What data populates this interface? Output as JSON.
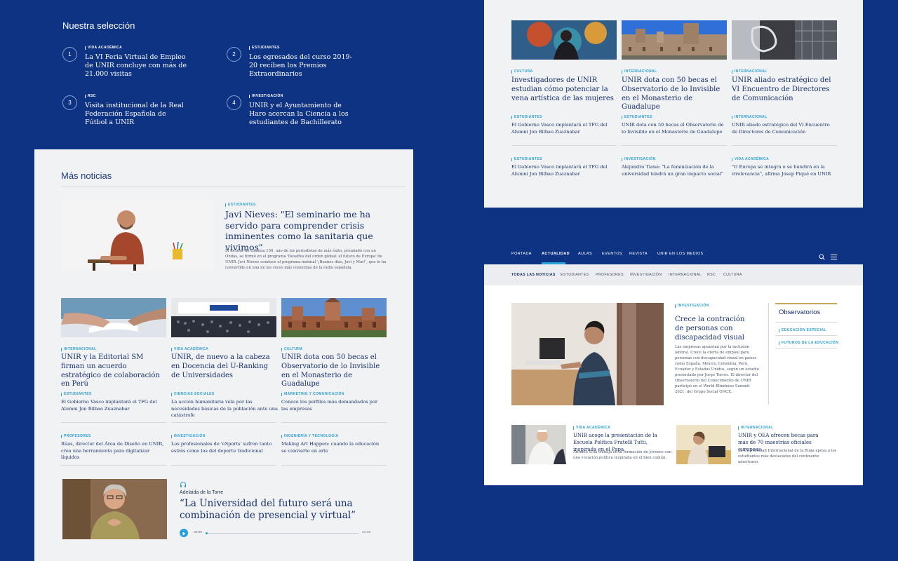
{
  "selection": {
    "title": "Nuestra selección",
    "items": [
      {
        "num": "1",
        "cat": "VIDA ACADÉMICA",
        "title": "La VI Feria Virtual de Empleo de UNIR concluye con más de 21.000 visitas"
      },
      {
        "num": "2",
        "cat": "ESTUDIANTES",
        "title": "Los egresados del curso 2019-20 reciben los Premios Extraordinarios"
      },
      {
        "num": "3",
        "cat": "RSC",
        "title": "Visita institucional de la Real Federación Española de Fútbol a UNIR"
      },
      {
        "num": "4",
        "cat": "INVESTIGACIÓN",
        "title": "UNIR y el Ayuntamiento de Haro acercan la Ciencia a los estudiantes de Bachillerato"
      }
    ]
  },
  "more": {
    "title": "Más noticias",
    "feature": {
      "cat": "ESTUDIANTES",
      "title": "Javi Nieves: \"El seminario me ha servido para comprender crisis inminentes como la sanitaria que vivimos\"",
      "body": "El locutor de Cadena 100, uno de los periodistas de más éxito, premiado con un Ondas, se formó en el programa 'Desafíos del orden global: el futuro de Europa' de UNIR. Javi Nieves conduce el programa matinal '¡Buenos días, Javi y Mar!', que le ha convertido en una de las voces más conocidas de la radio española."
    },
    "cards": [
      {
        "cat": "INTERNACIONAL",
        "title": "UNIR y la Editorial SM firman un acuerdo estratégico de colaboración en Perú"
      },
      {
        "cat": "VIDA ACADÉMICA",
        "title": "UNIR, de nuevo a la cabeza en Docencia del U-Ranking de Universidades"
      },
      {
        "cat": "CULTURA",
        "title": "UNIR dota con 50 becas el Observatorio de lo Invisible en el Monasterio de Guadalupe"
      }
    ],
    "small": [
      {
        "cat": "ESTUDIANTES",
        "title": "El Gobierno Vasco implantará el TFG del Alumni Jon Bilbao Zuaznabar"
      },
      {
        "cat": "CIENCIAS SOCIALES",
        "title": "La acción humanitaria vela por las necesidades básicas de la población ante una catástrofe"
      },
      {
        "cat": "MARKETING Y COMUNICACIÓN",
        "title": "Conoce los perfiles más demandados por las empresas"
      },
      {
        "cat": "PROFESORES",
        "title": "Rúas, director del Área de Diseño en UNIR, crea una herramienta para digitalizar líquidos"
      },
      {
        "cat": "INVESTIGACIÓN",
        "title": "Los profesionales de 'eSports' sufren tanto estrés como los del deporte tradicional"
      },
      {
        "cat": "INGENIERÍA Y TECNOLOGÍA",
        "title": "Making Art Happen: cuando la educación se convierte en arte"
      }
    ],
    "podcast": {
      "author": "Adelaida de la Torre",
      "quote": "“La Universidad del futuro será una combinación de presencial y virtual”",
      "time_start": "00:00",
      "time_end": "41:18",
      "progress": 0.01
    }
  },
  "right_top": {
    "cards": [
      {
        "cat": "CULTURA",
        "title": "Investigadores de UNIR estudian cómo potenciar la vena artística de las mujeres"
      },
      {
        "cat": "INTERNACIONAL",
        "title": "UNIR dota con 50 becas el Observatorio de lo Invisible en el Monasterio de Guadalupe"
      },
      {
        "cat": "INTERNACIONAL",
        "title": "UNIR aliado estratégico del VI Encuentro de Directores de Comunicación"
      }
    ],
    "small": [
      {
        "cat": "ESTUDIANTES",
        "title": "El Gobierno Vasco implantará el TFG del Alumni Jon Bilbao Zuaznabar"
      },
      {
        "cat": "ESTUDIANTES",
        "title": "UNIR dota con 50 becas el Observatorio de lo Invisible en el Monasterio de Guadalupe"
      },
      {
        "cat": "INTERNACIONAL",
        "title": "UNIR aliado estratégico del VI Encuentro de Directores de Comunicación"
      },
      {
        "cat": "ESTUDIANTES",
        "title": "El Gobierno Vasco implantará el TFG del Alumni Jon Bilbao Zuaznabar"
      },
      {
        "cat": "INVESTIGACIÓN",
        "title": "Alejandro Tiana: \"La feminización de la universidad tendrá un gran impacto social\""
      },
      {
        "cat": "VIDA ACADÉMICA",
        "title": "\"O Europa se integra o se hundirá en la irrelevancia\", afirma Josep Piqué en UNIR"
      }
    ]
  },
  "site": {
    "nav": [
      "PORTADA",
      "ACTUALIDAD",
      "AULAS",
      "EVENTOS",
      "REVISTA",
      "UNIR EN LOS MEDIOS"
    ],
    "subnav": [
      "TODAS LAS NOTICIAS",
      "ESTUDIANTES",
      "PROFESORES",
      "INVESTIGACIÓN",
      "INTERNACIONAL",
      "RSC",
      "CULTURA"
    ],
    "lead": {
      "cat": "INVESTIGACIÓN",
      "title": "Crece la contración de personas con discapacidad visual",
      "body": "Las empresas apuestan por la inclusión laboral. Crece la oferta de empleo para personas con discapacidad visual en países como España, México, Colombia, Perú, Ecuador y Estados Unidos, según un estudio presentado por Jorge Torres. El director del Observatorio del Conocimiento de UNIR participó en el World Blindness Summit 2021, del Grupo Social ONCE."
    },
    "sidebar": {
      "title": "Observatorios",
      "links": [
        "EDUCACIÓN ESPECIAL",
        "FUTUROS DE LA EDUCACIÓN"
      ]
    },
    "bottom": [
      {
        "cat": "VIDA ACADÉMICA",
        "title": "UNIR acoge la presentación de la Escuela Política Fratelli Tutti, inspirada en el Papa",
        "body": "Antonio Sola trabaja en la formación de jóvenes con una vocación política inspirada en el bien común."
      },
      {
        "cat": "INTERNACIONAL",
        "title": "UNIR y OEA ofrecen becas para más de 70 maestrías oficiales europeas",
        "body": "La Universidad Internacional de la Rioja apoya a los estudiantes más destacados del continente americano."
      }
    ]
  }
}
